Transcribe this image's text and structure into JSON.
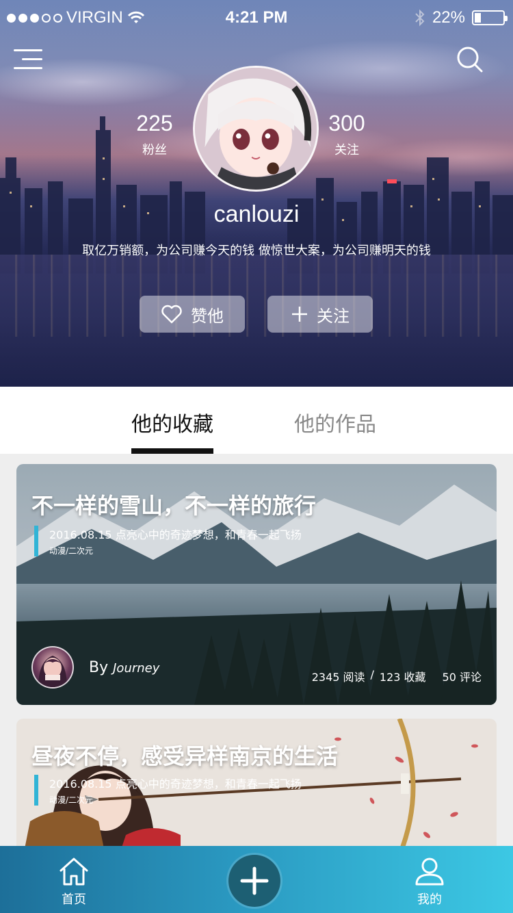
{
  "status_bar": {
    "carrier": "VIRGIN",
    "time": "4:21 PM",
    "battery": "22%",
    "battery_fraction": 0.22,
    "icons": [
      "signal-dots-icon",
      "wifi-icon",
      "bluetooth-icon",
      "battery-icon"
    ]
  },
  "header": {
    "menu_icon": "menu-icon",
    "search_icon": "search-icon"
  },
  "profile": {
    "fans_count": "225",
    "fans_label": "粉丝",
    "follow_count": "300",
    "follow_label": "关注",
    "username": "canlouzi",
    "bio": "取亿万销额，为公司赚今天的钱 做惊世大案，为公司赚明天的钱",
    "like_button": "赞他",
    "follow_button": "关注"
  },
  "tabs": [
    {
      "label": "他的收藏",
      "active": true
    },
    {
      "label": "他的作品",
      "active": false
    }
  ],
  "cards": [
    {
      "title": "不一样的雪山，不一样的旅行",
      "subtitle": "2016.08.15 点亮心中的奇迹梦想，和青春一起飞扬",
      "tag": "动漫/二次元",
      "author_prefix": "By",
      "author_name": "Journey",
      "reads": "2345 阅读",
      "separator": "/",
      "favorites": "123 收藏",
      "comments": "50 评论"
    },
    {
      "title": "昼夜不停，感受异样南京的生活",
      "subtitle": "2016.08.15 点亮心中的奇迹梦想，和青春一起飞扬",
      "tag": "动漫/二次元"
    }
  ],
  "bottom_nav": {
    "home_label": "首页",
    "mine_label": "我的",
    "add_icon": "plus-icon"
  },
  "colors": {
    "accent": "#31b4d6",
    "nav_start": "#1d6f99",
    "nav_end": "#3cc8e4",
    "add_button": "#1d5f73"
  }
}
